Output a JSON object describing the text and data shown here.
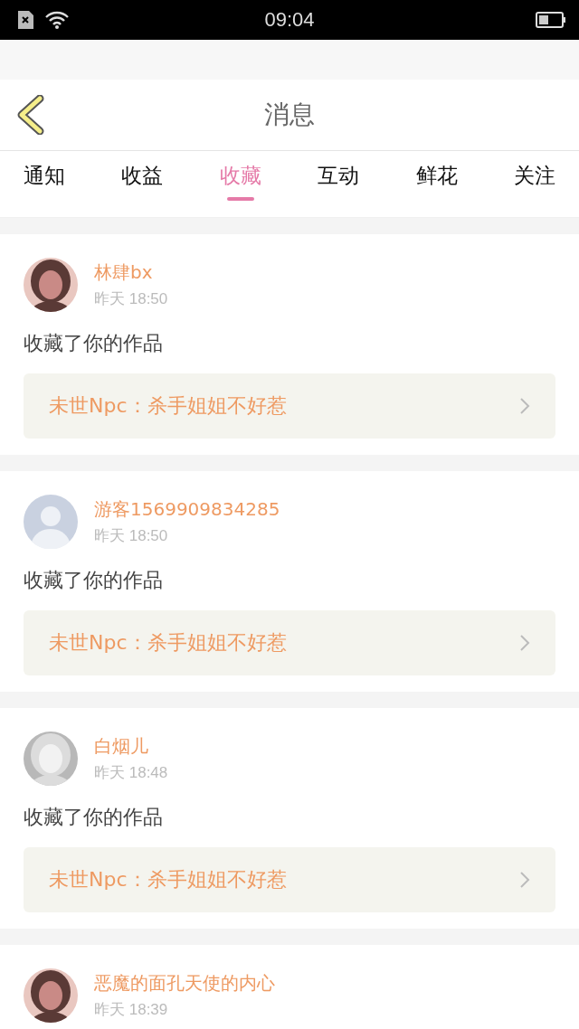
{
  "status_bar": {
    "time": "09:04"
  },
  "header": {
    "title": "消息"
  },
  "tabs": [
    {
      "label": "通知",
      "selected": false
    },
    {
      "label": "收益",
      "selected": false
    },
    {
      "label": "收藏",
      "selected": true
    },
    {
      "label": "互动",
      "selected": false
    },
    {
      "label": "鲜花",
      "selected": false
    },
    {
      "label": "关注",
      "selected": false
    }
  ],
  "messages": [
    {
      "name": "林肆bx",
      "time": "昨天 18:50",
      "text": "收藏了你的作品",
      "work": "未世Npc：杀手姐姐不好惹"
    },
    {
      "kind": "default",
      "name": "游客1569909834285",
      "time": "昨天 18:50",
      "text": "收藏了你的作品",
      "work": "未世Npc：杀手姐姐不好惹"
    },
    {
      "name": "白烟儿",
      "time": "昨天 18:48",
      "text": "收藏了你的作品",
      "work": "未世Npc：杀手姐姐不好惹"
    },
    {
      "name": "恶魔的面孔天使的内心",
      "time": "昨天 18:39"
    }
  ]
}
